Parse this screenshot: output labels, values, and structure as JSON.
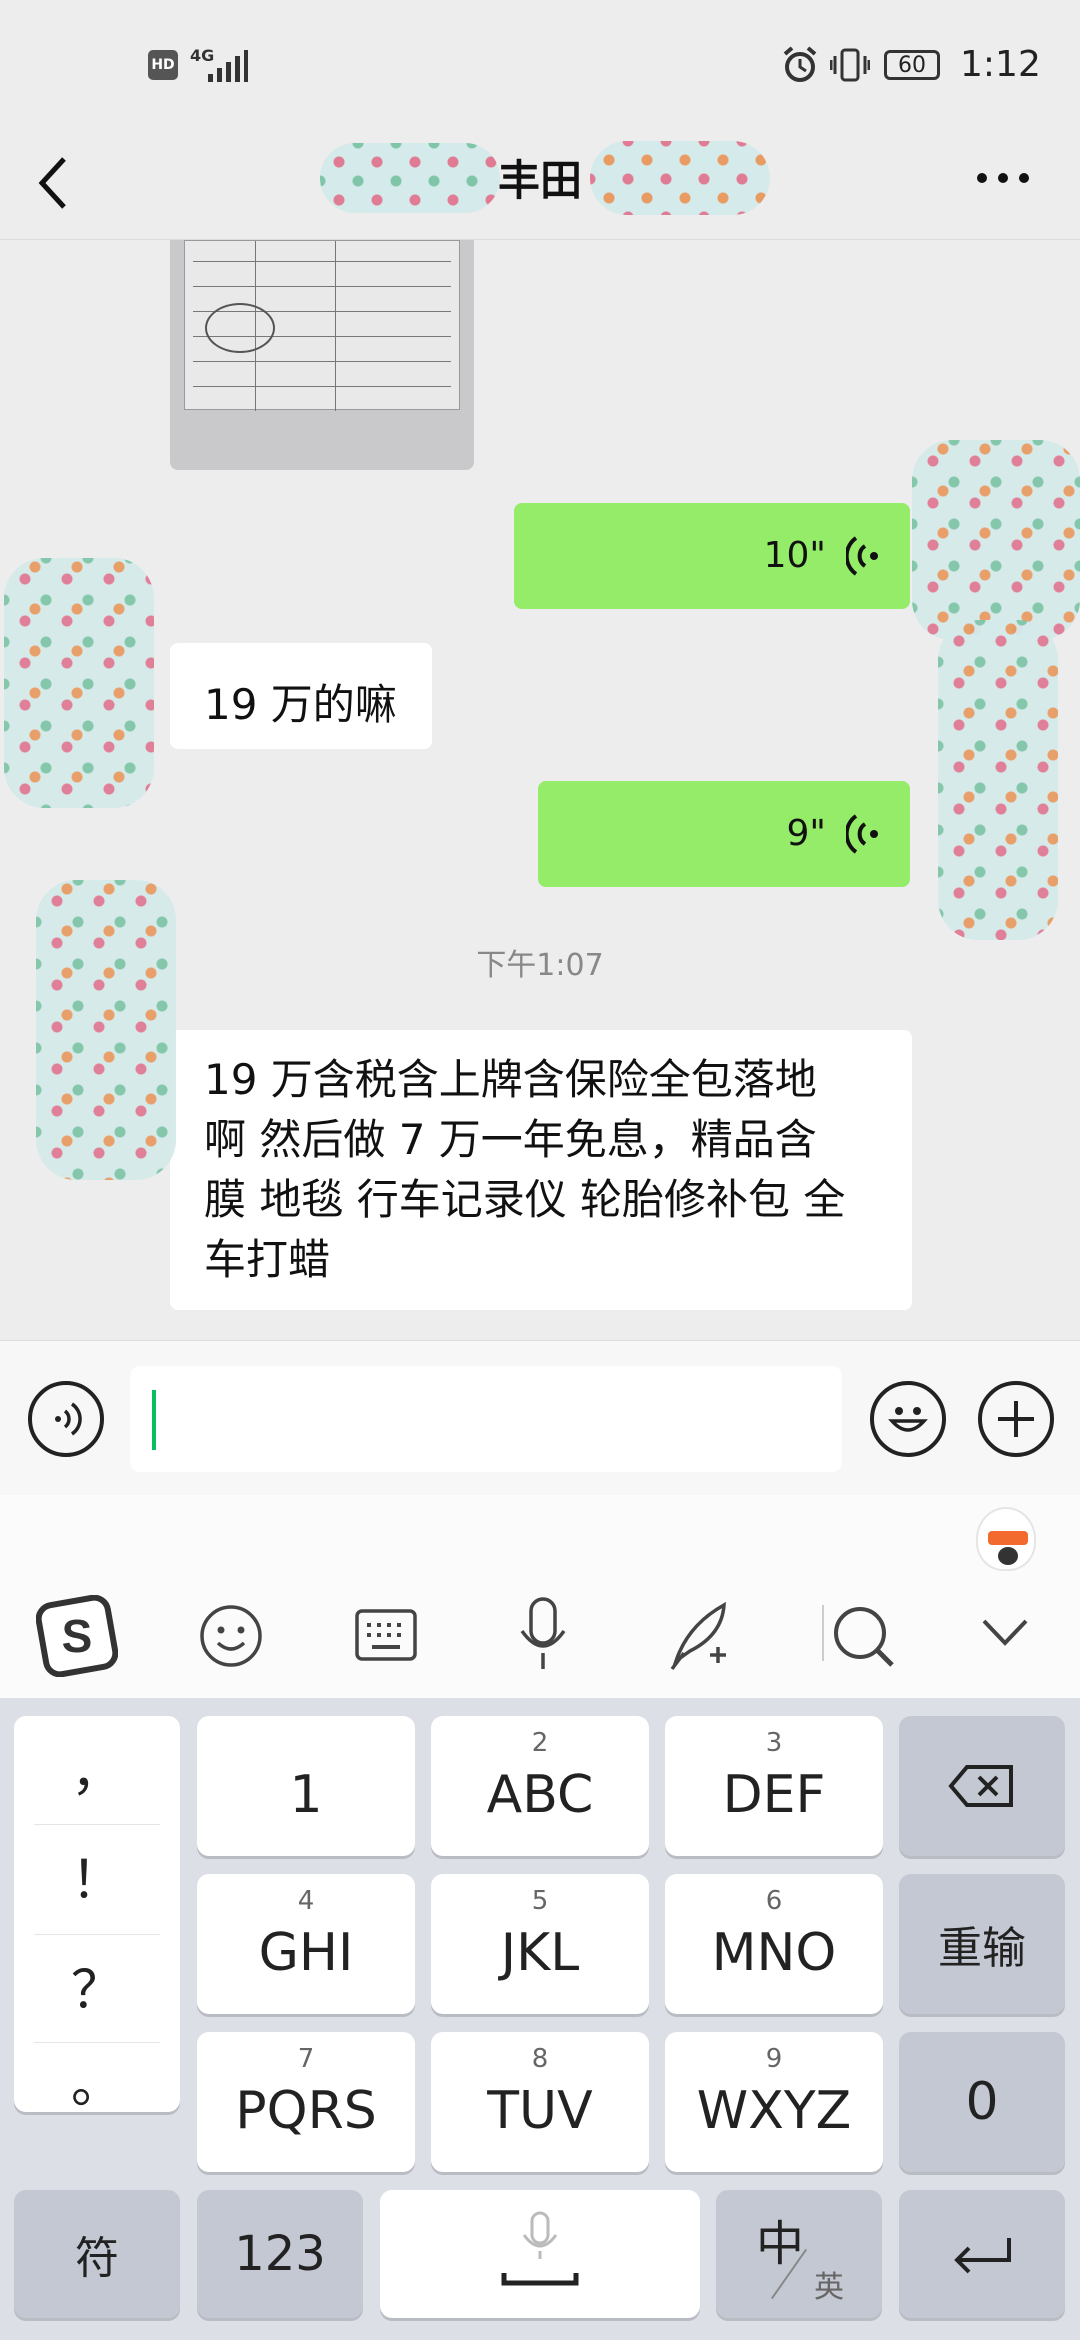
{
  "status_bar": {
    "hd_badge": "HD",
    "network": "4G",
    "battery": "60",
    "time": "1:12",
    "icons": [
      "hd-icon",
      "signal-icon",
      "alarm-icon",
      "vibrate-icon",
      "battery-icon"
    ]
  },
  "header": {
    "title": "丰田",
    "back_icon": "back-chevron-icon",
    "more_icon": "more-dots-icon"
  },
  "chat": {
    "messages": [
      {
        "side": "left",
        "type": "image"
      },
      {
        "side": "right",
        "type": "voice",
        "duration": "10\""
      },
      {
        "side": "left",
        "type": "text",
        "text": "19 万的嘛"
      },
      {
        "side": "right",
        "type": "voice",
        "duration": "9\""
      },
      {
        "type": "timestamp",
        "text": "下午1:07"
      },
      {
        "side": "left",
        "type": "text",
        "text_lines": [
          "19 万含税含上牌含保险全包落地",
          "啊 然后做 7 万一年免息，精品含",
          "膜 地毯 行车记录仪 轮胎修补包 全",
          "车打蜡"
        ]
      }
    ]
  },
  "input_bar": {
    "value": "",
    "voice_icon": "voice-mode-icon",
    "emoji_icon": "emoji-icon",
    "plus_icon": "plus-icon"
  },
  "ime_toolbar": {
    "icons": [
      "sogou-logo-icon",
      "emoji-face-icon",
      "keyboard-icon",
      "microphone-icon",
      "handwriting-icon",
      "search-icon",
      "collapse-chevron-icon"
    ]
  },
  "keyboard": {
    "punctuation": [
      "，",
      "！",
      "？",
      "。"
    ],
    "keys": [
      {
        "num": "",
        "label": "1"
      },
      {
        "num": "2",
        "label": "ABC"
      },
      {
        "num": "3",
        "label": "DEF"
      },
      {
        "num": "4",
        "label": "GHI"
      },
      {
        "num": "5",
        "label": "JKL"
      },
      {
        "num": "6",
        "label": "MNO"
      },
      {
        "num": "7",
        "label": "PQRS"
      },
      {
        "num": "8",
        "label": "TUV"
      },
      {
        "num": "9",
        "label": "WXYZ"
      }
    ],
    "reenter": "重输",
    "zero": "0",
    "symbols": "符",
    "numbers": "123",
    "lang_main": "中",
    "lang_sub": "英"
  }
}
